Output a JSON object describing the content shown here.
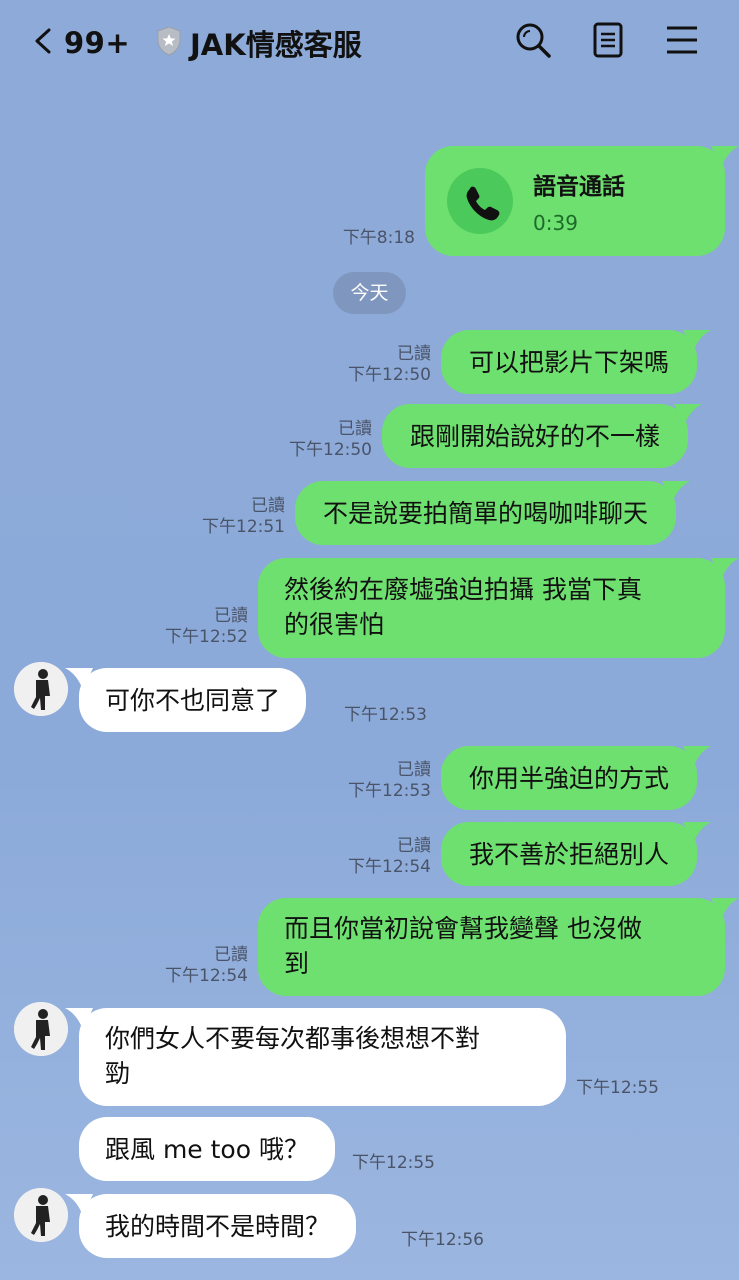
{
  "header": {
    "back_count": "99+",
    "title": "JAK情感客服"
  },
  "date_separator": "今天",
  "call": {
    "title": "語音通話",
    "duration": "0:39",
    "time": "下午8:18"
  },
  "messages": [
    {
      "dir": "out",
      "text": "可以把影片下架嗎",
      "read": "已讀",
      "time": "下午12:50"
    },
    {
      "dir": "out",
      "text": "跟剛開始說好的不一樣",
      "read": "已讀",
      "time": "下午12:50"
    },
    {
      "dir": "out",
      "text": "不是說要拍簡單的喝咖啡聊天",
      "read": "已讀",
      "time": "下午12:51"
    },
    {
      "dir": "out",
      "line1": "然後約在廢墟強迫拍攝 我當下真",
      "line2": "的很害怕",
      "read": "已讀",
      "time": "下午12:52"
    },
    {
      "dir": "in",
      "text": "可你不也同意了",
      "time": "下午12:53"
    },
    {
      "dir": "out",
      "text": "你用半強迫的方式",
      "read": "已讀",
      "time": "下午12:53"
    },
    {
      "dir": "out",
      "text": "我不善於拒絕別人",
      "read": "已讀",
      "time": "下午12:54"
    },
    {
      "dir": "out",
      "line1": "而且你當初說會幫我變聲 也沒做",
      "line2": "到",
      "read": "已讀",
      "time": "下午12:54"
    },
    {
      "dir": "in",
      "line1": "你們女人不要每次都事後想想不對",
      "line2": "勁",
      "time": "下午12:55"
    },
    {
      "dir": "in",
      "text": "跟風 me too 哦？",
      "time": "下午12:55"
    },
    {
      "dir": "in",
      "text": "我的時間不是時間？",
      "time": "下午12:56"
    }
  ]
}
